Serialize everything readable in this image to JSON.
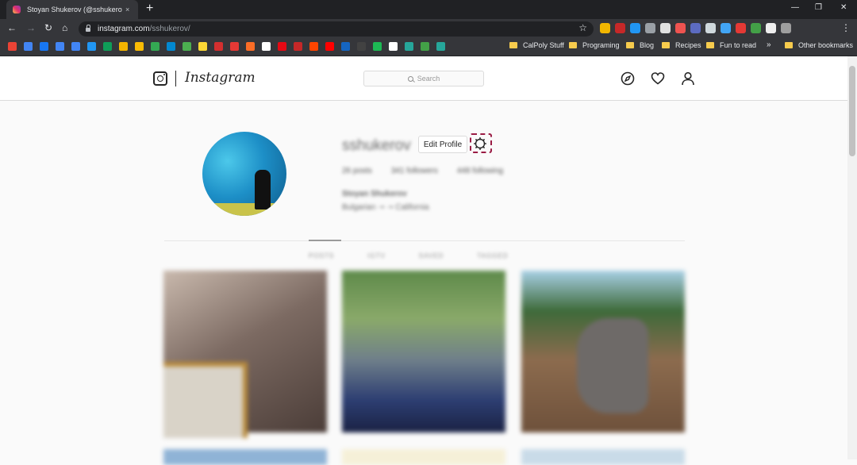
{
  "browser": {
    "tab_title": "Stoyan Shukerov (@sshukerov) ·",
    "tab_close": "×",
    "new_tab": "+",
    "window_controls": [
      "—",
      "❐",
      "✕"
    ],
    "url_domain": "instagram.com",
    "url_path": "/sshukerov/",
    "nav": {
      "back": "←",
      "forward": "→",
      "reload": "↻",
      "home": "⌂"
    },
    "star": "☆",
    "menu": "⋮",
    "extension_colors": [
      "#f2b600",
      "#c62828",
      "#2196f3",
      "#9aa0a6",
      "#e0e0e0",
      "#ef5350",
      "#5c6bc0",
      "#cfd8dc",
      "#42a5f5",
      "#e53935",
      "#43a047",
      "#eeeeee",
      "#9e9e9e"
    ]
  },
  "bookmarks": {
    "icon_colors": [
      "#ea4335",
      "#4285f4",
      "#1877f2",
      "#4285f4",
      "#4285f4",
      "#2196f3",
      "#0f9d58",
      "#f4b400",
      "#fbbc04",
      "#34a853",
      "#0288d1",
      "#4caf50",
      "#fdd835",
      "#d32f2f",
      "#e53935",
      "#fc6d26",
      "#ffffff",
      "#e50914",
      "#c62828",
      "#ff4500",
      "#ff0000",
      "#1565c0",
      "#424242",
      "#1db954",
      "#ffffff",
      "#26a69a",
      "#43a047",
      "#26a69a"
    ],
    "folders": [
      "CalPoly Stuff",
      "Programing",
      "Blog",
      "Recipes",
      "Fun to read"
    ],
    "more": "»",
    "other": "Other bookmarks"
  },
  "instagram": {
    "logo_text": "Instagram",
    "search_placeholder": "Search",
    "nav_icons": [
      "compass-icon",
      "heart-icon",
      "person-icon"
    ],
    "profile": {
      "username": "sshukerov",
      "edit_profile_label": "Edit Profile",
      "posts": "26 posts",
      "followers": "341 followers",
      "following": "448 following",
      "full_name": "Stoyan Shukerov",
      "bio": "Bulgarian ➝ ➝ California"
    },
    "tabs": [
      "POSTS",
      "IGTV",
      "SAVED",
      "TAGGED"
    ],
    "accent_highlight": "#9a1c44"
  }
}
